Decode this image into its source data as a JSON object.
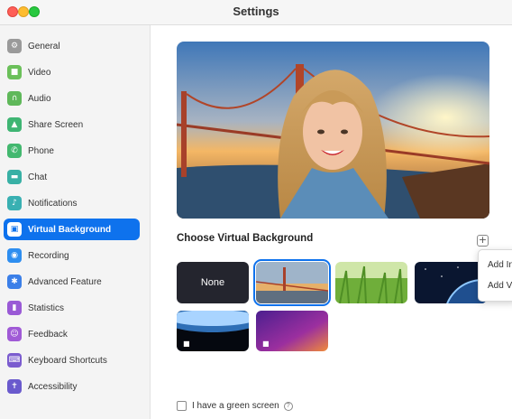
{
  "window": {
    "title": "Settings"
  },
  "sidebar": {
    "items": [
      {
        "label": "General",
        "icon": "gear-icon",
        "color": "#9a9a9a",
        "glyph": "⚙"
      },
      {
        "label": "Video",
        "icon": "video-camera-icon",
        "color": "#6bc05a",
        "glyph": "■"
      },
      {
        "label": "Audio",
        "icon": "headphones-icon",
        "color": "#5fb85a",
        "glyph": "∩"
      },
      {
        "label": "Share Screen",
        "icon": "share-screen-icon",
        "color": "#3fb573",
        "glyph": "▲"
      },
      {
        "label": "Phone",
        "icon": "phone-icon",
        "color": "#43b86f",
        "glyph": "✆"
      },
      {
        "label": "Chat",
        "icon": "chat-icon",
        "color": "#38b0a5",
        "glyph": "▬"
      },
      {
        "label": "Notifications",
        "icon": "bell-icon",
        "color": "#39b0b2",
        "glyph": "♪"
      },
      {
        "label": "Virtual Background",
        "icon": "person-background-icon",
        "color": "#0e72ed",
        "glyph": "▣",
        "active": true
      },
      {
        "label": "Recording",
        "icon": "record-icon",
        "color": "#2e8ef0",
        "glyph": "◉"
      },
      {
        "label": "Advanced Feature",
        "icon": "advanced-feature-icon",
        "color": "#3b7fe8",
        "glyph": "✱"
      },
      {
        "label": "Statistics",
        "icon": "statistics-icon",
        "color": "#9a5ad6",
        "glyph": "▮"
      },
      {
        "label": "Feedback",
        "icon": "feedback-icon",
        "color": "#a05ad6",
        "glyph": "☺"
      },
      {
        "label": "Keyboard Shortcuts",
        "icon": "keyboard-icon",
        "color": "#7b5ccf",
        "glyph": "⌨"
      },
      {
        "label": "Accessibility",
        "icon": "accessibility-icon",
        "color": "#6a5acd",
        "glyph": "✝"
      }
    ]
  },
  "main": {
    "section_title": "Choose Virtual Background",
    "add_button": "+",
    "thumbnails": [
      {
        "label": "None"
      },
      {
        "label": ""
      },
      {
        "label": ""
      },
      {
        "label": ""
      },
      {
        "label": "",
        "badge": "■"
      },
      {
        "label": "",
        "badge": "■"
      }
    ],
    "menu": {
      "items": [
        "Add In",
        "Add V"
      ]
    },
    "green_screen": {
      "label": "I have a green screen",
      "help": "?"
    }
  },
  "colors": {
    "accent": "#0e72ed"
  }
}
